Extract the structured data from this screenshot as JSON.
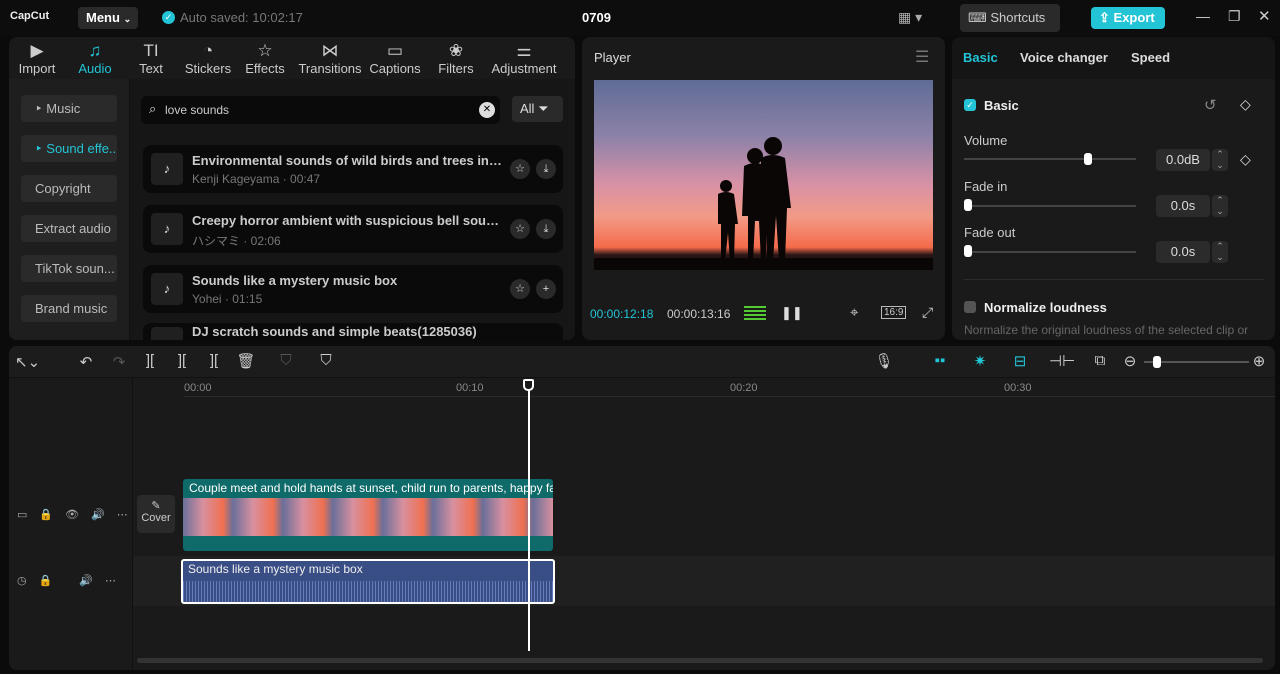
{
  "app": {
    "logo": "CapCut",
    "menu": "Menu",
    "autosave": "Auto saved: 10:02:17",
    "project": "0709",
    "shortcuts": "Shortcuts",
    "export": "Export"
  },
  "tabs": [
    {
      "label": "Import",
      "icon": "▶"
    },
    {
      "label": "Audio",
      "icon": "♫"
    },
    {
      "label": "Text",
      "icon": "TI"
    },
    {
      "label": "Stickers",
      "icon": "◔"
    },
    {
      "label": "Effects",
      "icon": "☆"
    },
    {
      "label": "Transitions",
      "icon": "⋈"
    },
    {
      "label": "Captions",
      "icon": "▭"
    },
    {
      "label": "Filters",
      "icon": "❀"
    },
    {
      "label": "Adjustment",
      "icon": "⚌"
    }
  ],
  "categories": [
    "‣ Music",
    "‣ Sound effe...",
    "Copyright",
    "Extract audio",
    "TikTok soun...",
    "Brand music"
  ],
  "search": {
    "value": "love sounds",
    "filter": "All"
  },
  "results": [
    {
      "title": "Environmental sounds of wild birds and trees in the forest",
      "sub": "Kenji Kageyama · 00:47",
      "action": "⤓"
    },
    {
      "title": "Creepy horror ambient with suspicious bell sounds",
      "sub": "ハシマミ · 02:06",
      "action": "⤓"
    },
    {
      "title": "Sounds like a mystery music box",
      "sub": "Yohei · 01:15",
      "action": "+"
    },
    {
      "title": "DJ scratch sounds and simple beats(1285036)",
      "sub": "",
      "action": ""
    }
  ],
  "player": {
    "title": "Player",
    "current": "00:00:12:18",
    "total": "00:00:13:16",
    "ratio": "16:9"
  },
  "right": {
    "tabs": [
      "Basic",
      "Voice changer",
      "Speed"
    ],
    "section": "Basic",
    "volume_label": "Volume",
    "volume": "0.0dB",
    "volume_pct": 0.72,
    "fadein_label": "Fade in",
    "fadein": "0.0s",
    "fadeout_label": "Fade out",
    "fadeout": "0.0s",
    "normalize": "Normalize loudness",
    "normalize_desc": "Normalize the original loudness of the selected clip or"
  },
  "timeline": {
    "ticks": [
      "00:00",
      "00:10",
      "00:20",
      "00:30"
    ],
    "video_clip": "Couple meet and hold hands at sunset, child run to parents, happy family",
    "cover": "Cover",
    "audio_clip": "Sounds like a mystery music box"
  },
  "colors": {
    "accent": "#22c4d6"
  }
}
